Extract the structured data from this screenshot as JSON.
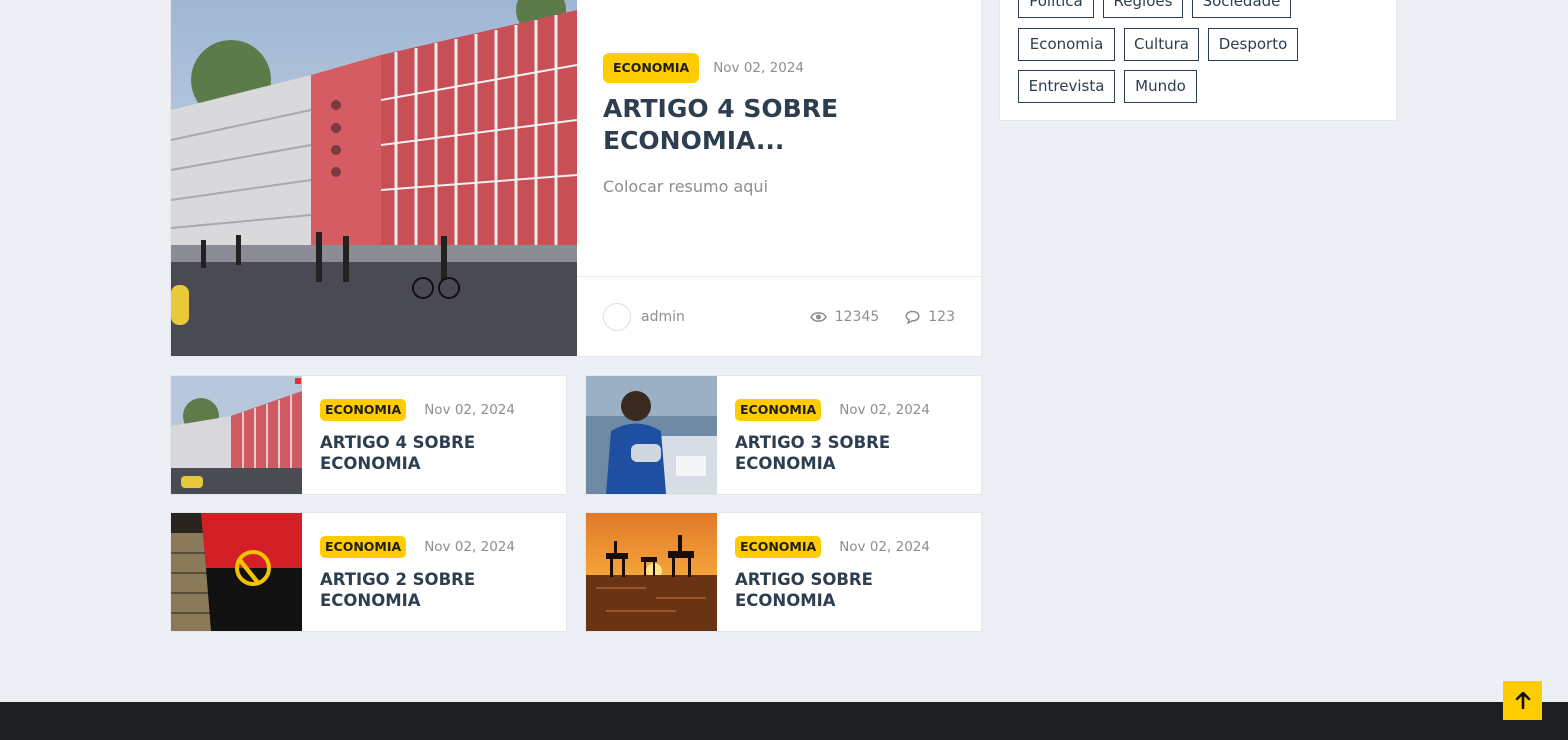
{
  "featured": {
    "category": "ECONOMIA",
    "date": "Nov 02, 2024",
    "title": "ARTIGO 4 SOBRE ECONOMIA...",
    "summary": "Colocar resumo aqui",
    "author": "admin",
    "views": "12345",
    "comments": "123"
  },
  "articles": [
    {
      "category": "ECONOMIA",
      "date": "Nov 02, 2024",
      "title": "ARTIGO 4 SOBRE ECONOMIA"
    },
    {
      "category": "ECONOMIA",
      "date": "Nov 02, 2024",
      "title": "ARTIGO 3 SOBRE ECONOMIA"
    },
    {
      "category": "ECONOMIA",
      "date": "Nov 02, 2024",
      "title": "ARTIGO 2 SOBRE ECONOMIA"
    },
    {
      "category": "ECONOMIA",
      "date": "Nov 02, 2024",
      "title": "ARTIGO SOBRE ECONOMIA"
    }
  ],
  "tags": [
    "Política",
    "Regiões",
    "Sociedade",
    "Economia",
    "Cultura",
    "Desporto",
    "Entrevista",
    "Mundo"
  ],
  "colors": {
    "accent": "#ffcc00",
    "heading": "#2c3e50",
    "muted": "#8e8e8e",
    "background": "#eceff4",
    "footer": "#1e1f23"
  },
  "icons": {
    "views": "eye-icon",
    "comments": "comment-icon",
    "back_to_top": "arrow-up-icon"
  }
}
